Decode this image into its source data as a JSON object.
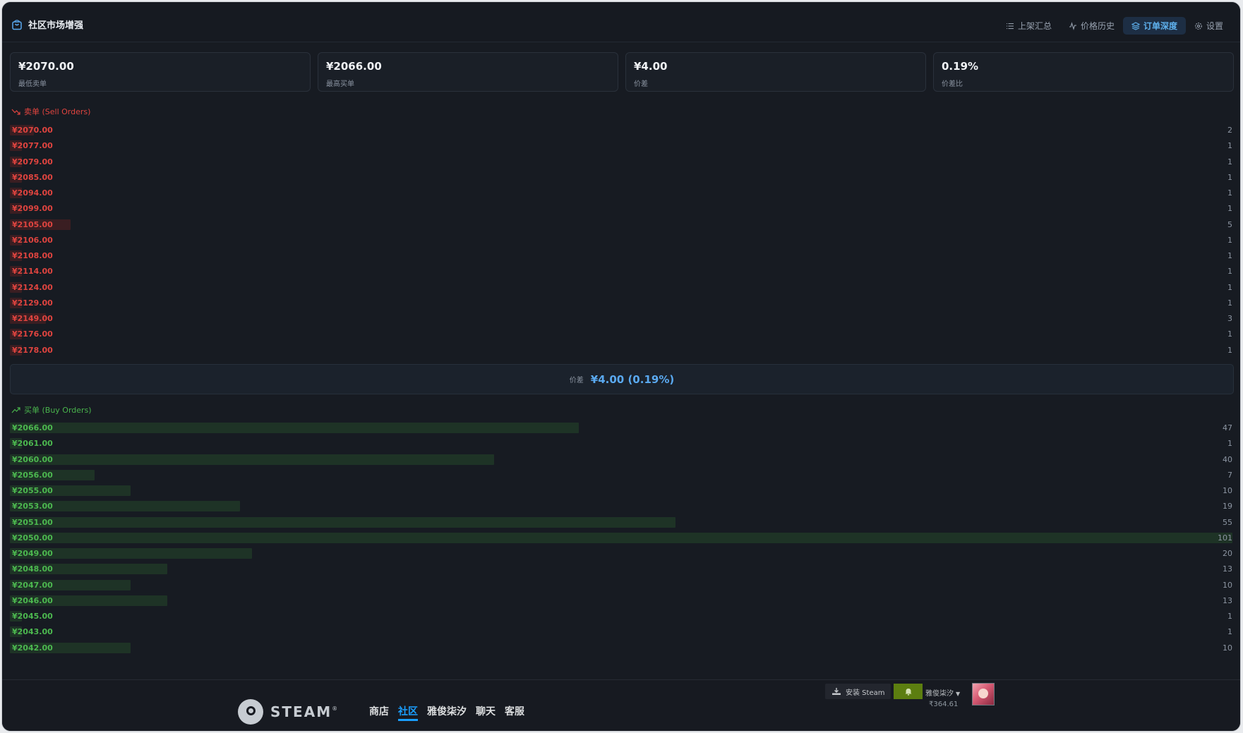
{
  "header": {
    "title": "社区市场增强",
    "tabs": [
      {
        "label": "上架汇总",
        "icon": "list-icon",
        "active": false
      },
      {
        "label": "价格历史",
        "icon": "activity-icon",
        "active": false
      },
      {
        "label": "订单深度",
        "icon": "layers-icon",
        "active": true
      },
      {
        "label": "设置",
        "icon": "gear-icon",
        "active": false
      }
    ]
  },
  "stats": [
    {
      "value": "¥2070.00",
      "label": "最低卖单"
    },
    {
      "value": "¥2066.00",
      "label": "最高买单"
    },
    {
      "value": "¥4.00",
      "label": "价差"
    },
    {
      "value": "0.19%",
      "label": "价差比"
    }
  ],
  "sell_orders": {
    "title": "卖单 (Sell Orders)",
    "rows": [
      {
        "price": "¥2070.00",
        "qty": 2
      },
      {
        "price": "¥2077.00",
        "qty": 1
      },
      {
        "price": "¥2079.00",
        "qty": 1
      },
      {
        "price": "¥2085.00",
        "qty": 1
      },
      {
        "price": "¥2094.00",
        "qty": 1
      },
      {
        "price": "¥2099.00",
        "qty": 1
      },
      {
        "price": "¥2105.00",
        "qty": 5
      },
      {
        "price": "¥2106.00",
        "qty": 1
      },
      {
        "price": "¥2108.00",
        "qty": 1
      },
      {
        "price": "¥2114.00",
        "qty": 1
      },
      {
        "price": "¥2124.00",
        "qty": 1
      },
      {
        "price": "¥2129.00",
        "qty": 1
      },
      {
        "price": "¥2149.00",
        "qty": 3
      },
      {
        "price": "¥2176.00",
        "qty": 1
      },
      {
        "price": "¥2178.00",
        "qty": 1
      }
    ]
  },
  "spread": {
    "label": "价差",
    "value": "¥4.00 (0.19%)"
  },
  "buy_orders": {
    "title": "买单 (Buy Orders)",
    "rows": [
      {
        "price": "¥2066.00",
        "qty": 47
      },
      {
        "price": "¥2061.00",
        "qty": 1
      },
      {
        "price": "¥2060.00",
        "qty": 40
      },
      {
        "price": "¥2056.00",
        "qty": 7
      },
      {
        "price": "¥2055.00",
        "qty": 10
      },
      {
        "price": "¥2053.00",
        "qty": 19
      },
      {
        "price": "¥2051.00",
        "qty": 55
      },
      {
        "price": "¥2050.00",
        "qty": 101
      },
      {
        "price": "¥2049.00",
        "qty": 20
      },
      {
        "price": "¥2048.00",
        "qty": 13
      },
      {
        "price": "¥2047.00",
        "qty": 10
      },
      {
        "price": "¥2046.00",
        "qty": 13
      },
      {
        "price": "¥2045.00",
        "qty": 1
      },
      {
        "price": "¥2043.00",
        "qty": 1
      },
      {
        "price": "¥2042.00",
        "qty": 10
      }
    ]
  },
  "max_qty": 101,
  "colors": {
    "sell": "#e0443f",
    "buy": "#4cb84f",
    "accent": "#5aa9f0",
    "steam_active": "#1a9fff"
  },
  "steam_footer": {
    "logo_text": "STEAM",
    "reg_mark": "®",
    "nav": [
      {
        "label": "商店",
        "active": false
      },
      {
        "label": "社区",
        "active": true
      },
      {
        "label": "雅俊柒汐",
        "active": false
      },
      {
        "label": "聊天",
        "active": false
      },
      {
        "label": "客服",
        "active": false
      }
    ],
    "install_label": "安装 Steam",
    "account_name": "雅俊柒汐",
    "balance": "₹364.61"
  }
}
